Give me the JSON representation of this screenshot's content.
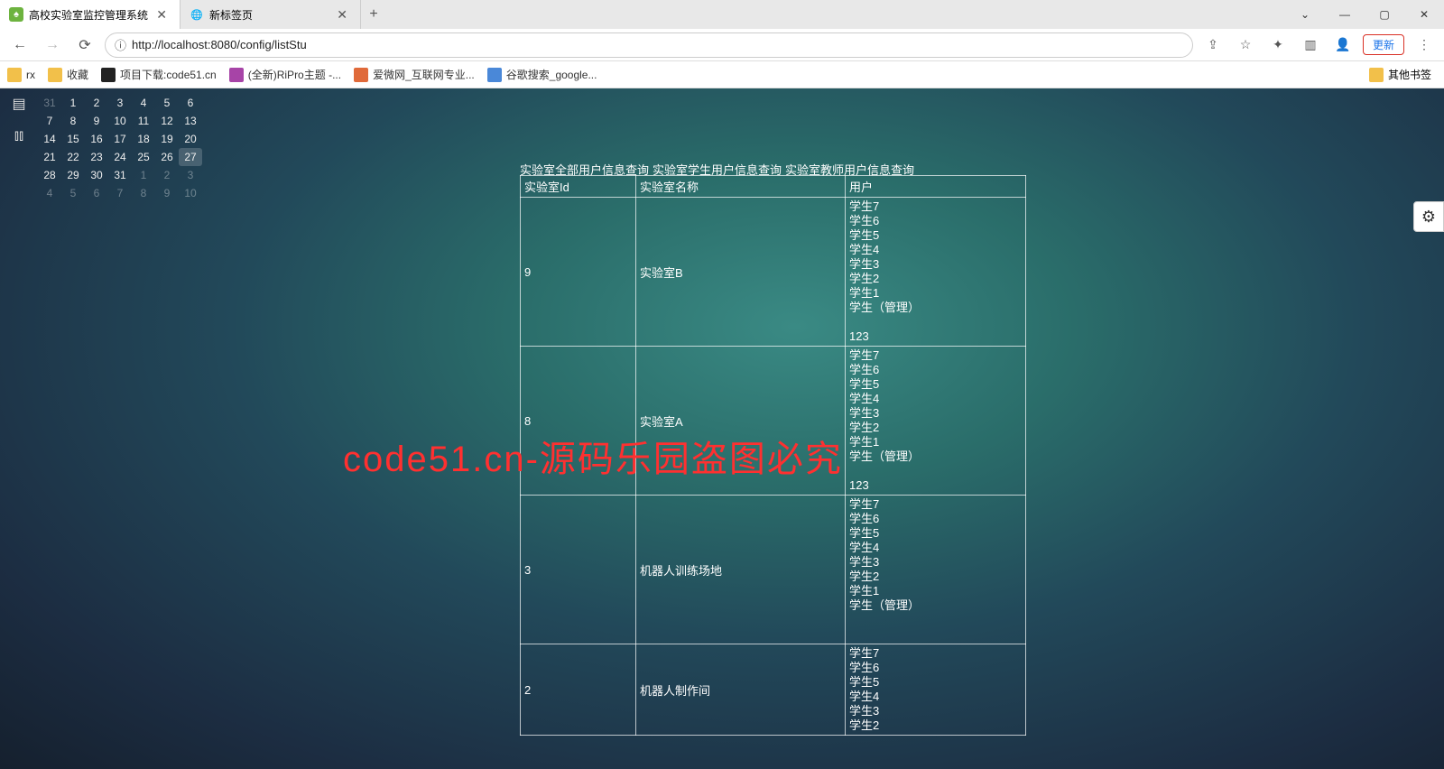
{
  "browser": {
    "tabs": [
      {
        "title": "高校实验室监控管理系统",
        "active": true
      },
      {
        "title": "新标签页",
        "active": false
      }
    ],
    "window_controls": {
      "min": "—",
      "max": "▢",
      "close": "✕",
      "dropdown": "⌄"
    },
    "nav": {
      "back": "←",
      "forward": "→",
      "reload": "⟳"
    },
    "url_info_icon": "ⓘ",
    "url": "http://localhost:8080/config/listStu",
    "url_host": "localhost",
    "addr_icons": {
      "share": "⇪",
      "star": "☆",
      "ext": "✦",
      "panel": "▥",
      "profile": "👤",
      "menu": "⋮"
    },
    "update_btn": "更新"
  },
  "bookmarks": {
    "items": [
      {
        "label": "rx",
        "color": "#f2c04a"
      },
      {
        "label": "收藏",
        "color": "#f2c04a"
      },
      {
        "label": "项目下载:code51.cn",
        "color": "#222"
      },
      {
        "label": "(全新)RiPro主题 -...",
        "color": "#a744a7"
      },
      {
        "label": "爱微网_互联网专业...",
        "color": "#e06a3a"
      },
      {
        "label": "谷歌搜索_google...",
        "color": "#4a88d8"
      }
    ],
    "other": "其他书签"
  },
  "calendar": {
    "rows": [
      [
        {
          "v": "31",
          "m": true
        },
        {
          "v": "1"
        },
        {
          "v": "2"
        },
        {
          "v": "3"
        },
        {
          "v": "4"
        },
        {
          "v": "5"
        },
        {
          "v": "6"
        }
      ],
      [
        {
          "v": "7"
        },
        {
          "v": "8"
        },
        {
          "v": "9"
        },
        {
          "v": "10"
        },
        {
          "v": "11"
        },
        {
          "v": "12"
        },
        {
          "v": "13"
        }
      ],
      [
        {
          "v": "14"
        },
        {
          "v": "15"
        },
        {
          "v": "16"
        },
        {
          "v": "17"
        },
        {
          "v": "18"
        },
        {
          "v": "19"
        },
        {
          "v": "20"
        }
      ],
      [
        {
          "v": "21"
        },
        {
          "v": "22"
        },
        {
          "v": "23"
        },
        {
          "v": "24"
        },
        {
          "v": "25"
        },
        {
          "v": "26"
        },
        {
          "v": "27",
          "h": true
        }
      ],
      [
        {
          "v": "28"
        },
        {
          "v": "29"
        },
        {
          "v": "30"
        },
        {
          "v": "31"
        },
        {
          "v": "1",
          "m": true
        },
        {
          "v": "2",
          "m": true
        },
        {
          "v": "3",
          "m": true
        }
      ],
      [
        {
          "v": "4",
          "m": true
        },
        {
          "v": "5",
          "m": true
        },
        {
          "v": "6",
          "m": true
        },
        {
          "v": "7",
          "m": true
        },
        {
          "v": "8",
          "m": true
        },
        {
          "v": "9",
          "m": true
        },
        {
          "v": "10",
          "m": true
        }
      ]
    ]
  },
  "page": {
    "tabs": [
      "实验室全部用户信息查询",
      "实验室学生用户信息查询",
      "实验室教师用户信息查询"
    ],
    "headers": {
      "id": "实验室Id",
      "name": "实验室名称",
      "user": "用户"
    },
    "rows": [
      {
        "id": "9",
        "name": "实验室B",
        "users": [
          "学生7",
          "学生6",
          "学生5",
          "学生4",
          "学生3",
          "学生2",
          "学生1",
          "学生（管理）",
          "",
          "123"
        ]
      },
      {
        "id": "8",
        "name": "实验室A",
        "users": [
          "学生7",
          "学生6",
          "学生5",
          "学生4",
          "学生3",
          "学生2",
          "学生1",
          "学生（管理）",
          "",
          "123"
        ]
      },
      {
        "id": "3",
        "name": "机器人训练场地",
        "users": [
          "学生7",
          "学生6",
          "学生5",
          "学生4",
          "学生3",
          "学生2",
          "学生1",
          "学生（管理）",
          "",
          ""
        ]
      },
      {
        "id": "2",
        "name": "机器人制作间",
        "users": [
          "学生7",
          "学生6",
          "学生5",
          "学生4",
          "学生3",
          "学生2"
        ]
      }
    ]
  },
  "watermark": "code51.cn-源码乐园盗图必究",
  "settings_icon": "⚙"
}
